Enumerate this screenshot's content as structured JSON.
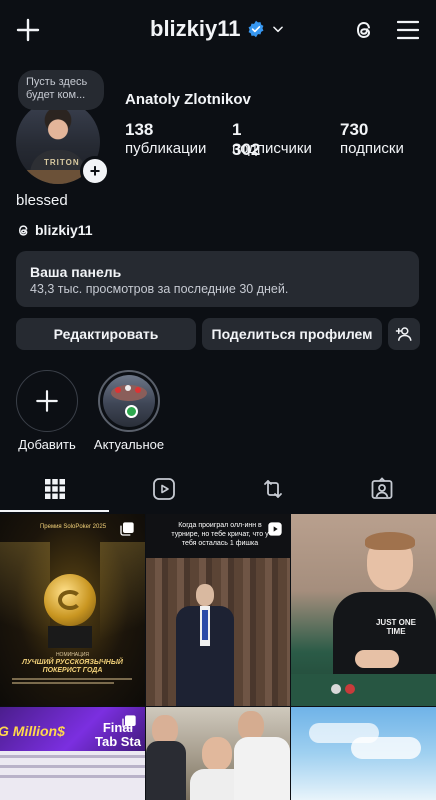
{
  "header": {
    "username": "blizkiy11",
    "icons": [
      "plus-icon",
      "verified-badge-icon",
      "chevron-down-icon",
      "threads-icon",
      "menu-icon"
    ]
  },
  "profile": {
    "note": "Пусть здесь будет ком...",
    "avatar_shirt_text": "TRITON",
    "full_name": "Anatoly Zlotnikov",
    "stats": [
      {
        "value": "138",
        "label": "публикации"
      },
      {
        "value": "1 302",
        "label": "подписчики"
      },
      {
        "value": "730",
        "label": "подписки"
      }
    ],
    "bio": "blessed",
    "threads_handle": "blizkiy11"
  },
  "dashboard": {
    "title": "Ваша панель",
    "subtitle": "43,3 тыс. просмотров за последние 30 дней."
  },
  "actions": {
    "edit_label": "Редактировать",
    "share_label": "Поделиться профилем"
  },
  "highlights": [
    {
      "label": "Добавить"
    },
    {
      "label": "Актуальное"
    }
  ],
  "tabs": [
    "grid-icon",
    "reels-icon",
    "reposts-icon",
    "tagged-icon"
  ],
  "posts": {
    "post1": {
      "header": "Премия SoloPoker 2025",
      "nomination": "НОМИНАЦИЯ",
      "title": "ЛУЧШИЙ РУССКОЯЗЫЧНЫЙ ПОКЕРИСТ ГОДА"
    },
    "post2": {
      "caption": "Когда проиграл олл-инн в турнире, но тебе кричат, что у тебя осталась 1 фишка"
    },
    "post3": {
      "shirt": "JUST ONE TIME"
    },
    "post4": {
      "left": "G Million$",
      "right": "Final Tab Sta"
    }
  },
  "colors": {
    "background": "#0c0f14",
    "surface": "#262a31",
    "text": "#f2f4f7",
    "muted": "#c6cad2",
    "verified": "#3797f0"
  }
}
